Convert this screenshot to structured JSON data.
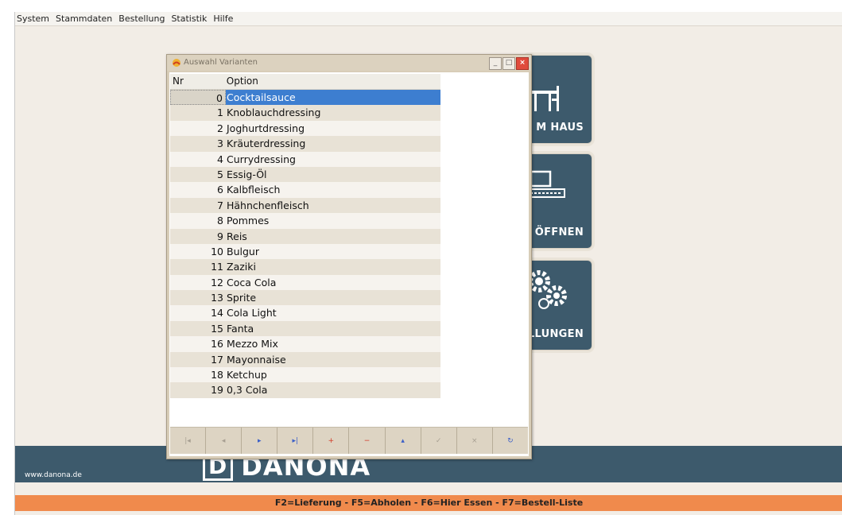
{
  "menu": [
    "System",
    "Stammdaten",
    "Bestellung",
    "Statistik",
    "Hilfe"
  ],
  "tiles": {
    "t1": "M HAUS",
    "t2": "SE ÖFFNEN",
    "t3": "TELLUNGEN"
  },
  "banner": {
    "site": "www.danona.de",
    "logo_letter": "D",
    "logo_text": "DANONA"
  },
  "status": "F2=Lieferung - F5=Abholen - F6=Hier Essen - F7=Bestell-Liste",
  "dialog": {
    "title": "Auswahl Varianten",
    "columns": {
      "nr": "Nr",
      "option": "Option"
    },
    "rows": [
      {
        "nr": "0",
        "option": "Cocktailsauce"
      },
      {
        "nr": "1",
        "option": "Knoblauchdressing"
      },
      {
        "nr": "2",
        "option": "Joghurtdressing"
      },
      {
        "nr": "3",
        "option": "Kräuterdressing"
      },
      {
        "nr": "4",
        "option": "Currydressing"
      },
      {
        "nr": "5",
        "option": "Essig-Öl"
      },
      {
        "nr": "6",
        "option": "Kalbfleisch"
      },
      {
        "nr": "7",
        "option": "Hähnchenfleisch"
      },
      {
        "nr": "8",
        "option": "Pommes"
      },
      {
        "nr": "9",
        "option": "Reis"
      },
      {
        "nr": "10",
        "option": "Bulgur"
      },
      {
        "nr": "11",
        "option": "Zaziki"
      },
      {
        "nr": "12",
        "option": "Coca Cola"
      },
      {
        "nr": "13",
        "option": "Sprite"
      },
      {
        "nr": "14",
        "option": "Cola Light"
      },
      {
        "nr": "15",
        "option": "Fanta"
      },
      {
        "nr": "16",
        "option": "Mezzo Mix"
      },
      {
        "nr": "17",
        "option": "Mayonnaise"
      },
      {
        "nr": "18",
        "option": "Ketchup"
      },
      {
        "nr": "19",
        "option": "0,3 Cola"
      }
    ],
    "selected_row": 0,
    "navigator": [
      {
        "name": "nav-first-button",
        "glyph": "|◂",
        "style": "dis"
      },
      {
        "name": "nav-prior-button",
        "glyph": "◂",
        "style": "dis"
      },
      {
        "name": "nav-next-button",
        "glyph": "▸",
        "style": "blue"
      },
      {
        "name": "nav-last-button",
        "glyph": "▸|",
        "style": "blue"
      },
      {
        "name": "nav-insert-button",
        "glyph": "+",
        "style": "red"
      },
      {
        "name": "nav-delete-button",
        "glyph": "−",
        "style": "red"
      },
      {
        "name": "nav-edit-button",
        "glyph": "▴",
        "style": "blue"
      },
      {
        "name": "nav-post-button",
        "glyph": "✓",
        "style": "gray"
      },
      {
        "name": "nav-cancel-button",
        "glyph": "×",
        "style": "gray"
      },
      {
        "name": "nav-refresh-button",
        "glyph": "↻",
        "style": "blue"
      }
    ]
  },
  "colors": {
    "tile": "#3d5a6c",
    "status_bar": "#f08a4c",
    "selection": "#3d7ed0"
  }
}
